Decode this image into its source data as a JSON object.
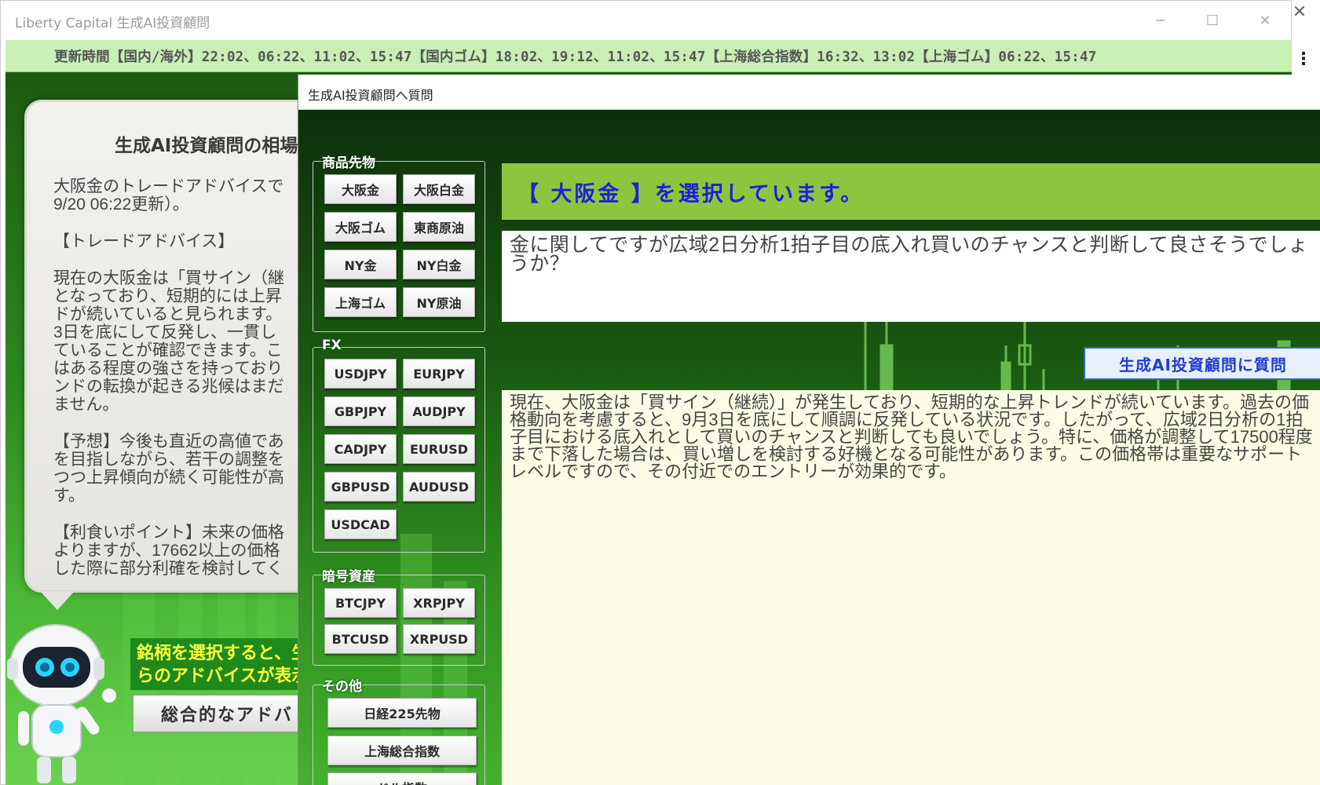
{
  "window": {
    "title": "Liberty Capital 生成AI投資顧問",
    "minimize": "─",
    "maximize": "☐",
    "close": "✕",
    "outer_close": "✕",
    "more": "⋮"
  },
  "update_bar": {
    "text": "更新時間【国内/海外】22:02、06:22、11:02、15:47【国内ゴム】18:02、19:12、11:02、15:47【上海総合指数】16:32、13:02【上海ゴム】06:22、15:47"
  },
  "advice_panel": {
    "title": "生成AI投資顧問の相場",
    "paragraphs": [
      "大阪金のトレードアドバイスで\n9/20 06:22更新）。",
      "【トレードアドバイス】",
      "現在の大阪金は「買サイン（継\nとなっており、短期的には上昇\nドが続いていると見られます。\n3日を底にして反発し、一貫し\nていることが確認できます。こ\nはある程度の強さを持っており\nンドの転換が起きる兆候はまだ\nません。",
      "【予想】今後も直近の高値であ\nを目指しながら、若干の調整を\nつつ上昇傾向が続く可能性が高\nす。",
      "【利食いポイント】未来の価格\nよりますが、17662以上の価格\nした際に部分利確を検討してく"
    ]
  },
  "hint_banner": "銘柄を選択すると、生\nらのアドバイスが表示さ",
  "overall_button": "総合的なアドバ",
  "dialog": {
    "title": "生成AI投資顧問へ質問",
    "groups": {
      "commodity": {
        "legend": "商品先物",
        "buttons": [
          "大阪金",
          "大阪白金",
          "大阪ゴム",
          "東商原油",
          "NY金",
          "NY白金",
          "上海ゴム",
          "NY原油"
        ]
      },
      "fx": {
        "legend": "FX",
        "buttons": [
          "USDJPY",
          "EURJPY",
          "GBPJPY",
          "AUDJPY",
          "CADJPY",
          "EURUSD",
          "GBPUSD",
          "AUDUSD",
          "USDCAD"
        ]
      },
      "crypto": {
        "legend": "暗号資産",
        "buttons": [
          "BTCJPY",
          "XRPJPY",
          "BTCUSD",
          "XRPUSD"
        ]
      },
      "other": {
        "legend": "その他",
        "buttons": [
          "日経225先物",
          "上海総合指数",
          "ドル指数"
        ]
      }
    },
    "selected_text": "【 大阪金 】を選択しています。",
    "question": "金に関してですが広域2日分析1拍子目の底入れ買いのチャンスと判断して良さそうでしょうか？",
    "ask_button": "生成AI投資顧問に質問",
    "answer": "現在、大阪金は「買サイン（継続）」が発生しており、短期的な上昇トレンドが続いています。過去の価格動向を考慮すると、9月3日を底にして順調に反発している状況です。したがって、広域2日分析の1拍子目における底入れとして買いのチャンスと判断しても良いでしょう。特に、価格が調整して17500程度まで下落した場合は、買い増しを検討する好機となる可能性があります。この価格帯は重要なサポートレベルですので、その付近でのエントリーが効果的です。"
  }
}
